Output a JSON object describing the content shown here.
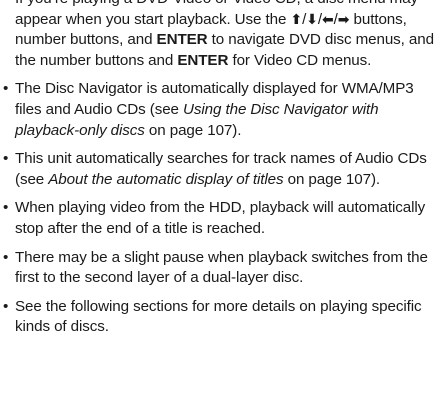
{
  "bullets": [
    {
      "pre": "If you’re playing a DVD-Video or Video CD, a disc menu may appear when you start playback. Use the ",
      "arrows": [
        "⬆",
        "⬇",
        "⬅",
        "➡"
      ],
      "sep": "/",
      "mid1": " buttons, number buttons, and ",
      "enter1": "ENTER",
      "mid2": " to navigate DVD disc menus, and the number buttons and ",
      "enter2": "ENTER",
      "post": " for Video CD menus."
    },
    {
      "pre": "The Disc Navigator is automatically displayed for WMA/MP3 files and Audio CDs (see ",
      "ref": "Using the Disc Navigator with playback-only discs",
      "post": " on page 107)."
    },
    {
      "pre": "This unit automatically searches for track names of Audio CDs (see ",
      "ref": "About the automatic display of titles",
      "post": " on page 107)."
    },
    {
      "text": "When playing video from the HDD, playback will automatically stop after the end of a title is reached."
    },
    {
      "text": "There may be a slight pause when playback switches from the first to the second layer of a dual-layer disc."
    },
    {
      "text": "See the following sections for more details on playing specific kinds of discs."
    }
  ],
  "bullet_glyph": "•"
}
